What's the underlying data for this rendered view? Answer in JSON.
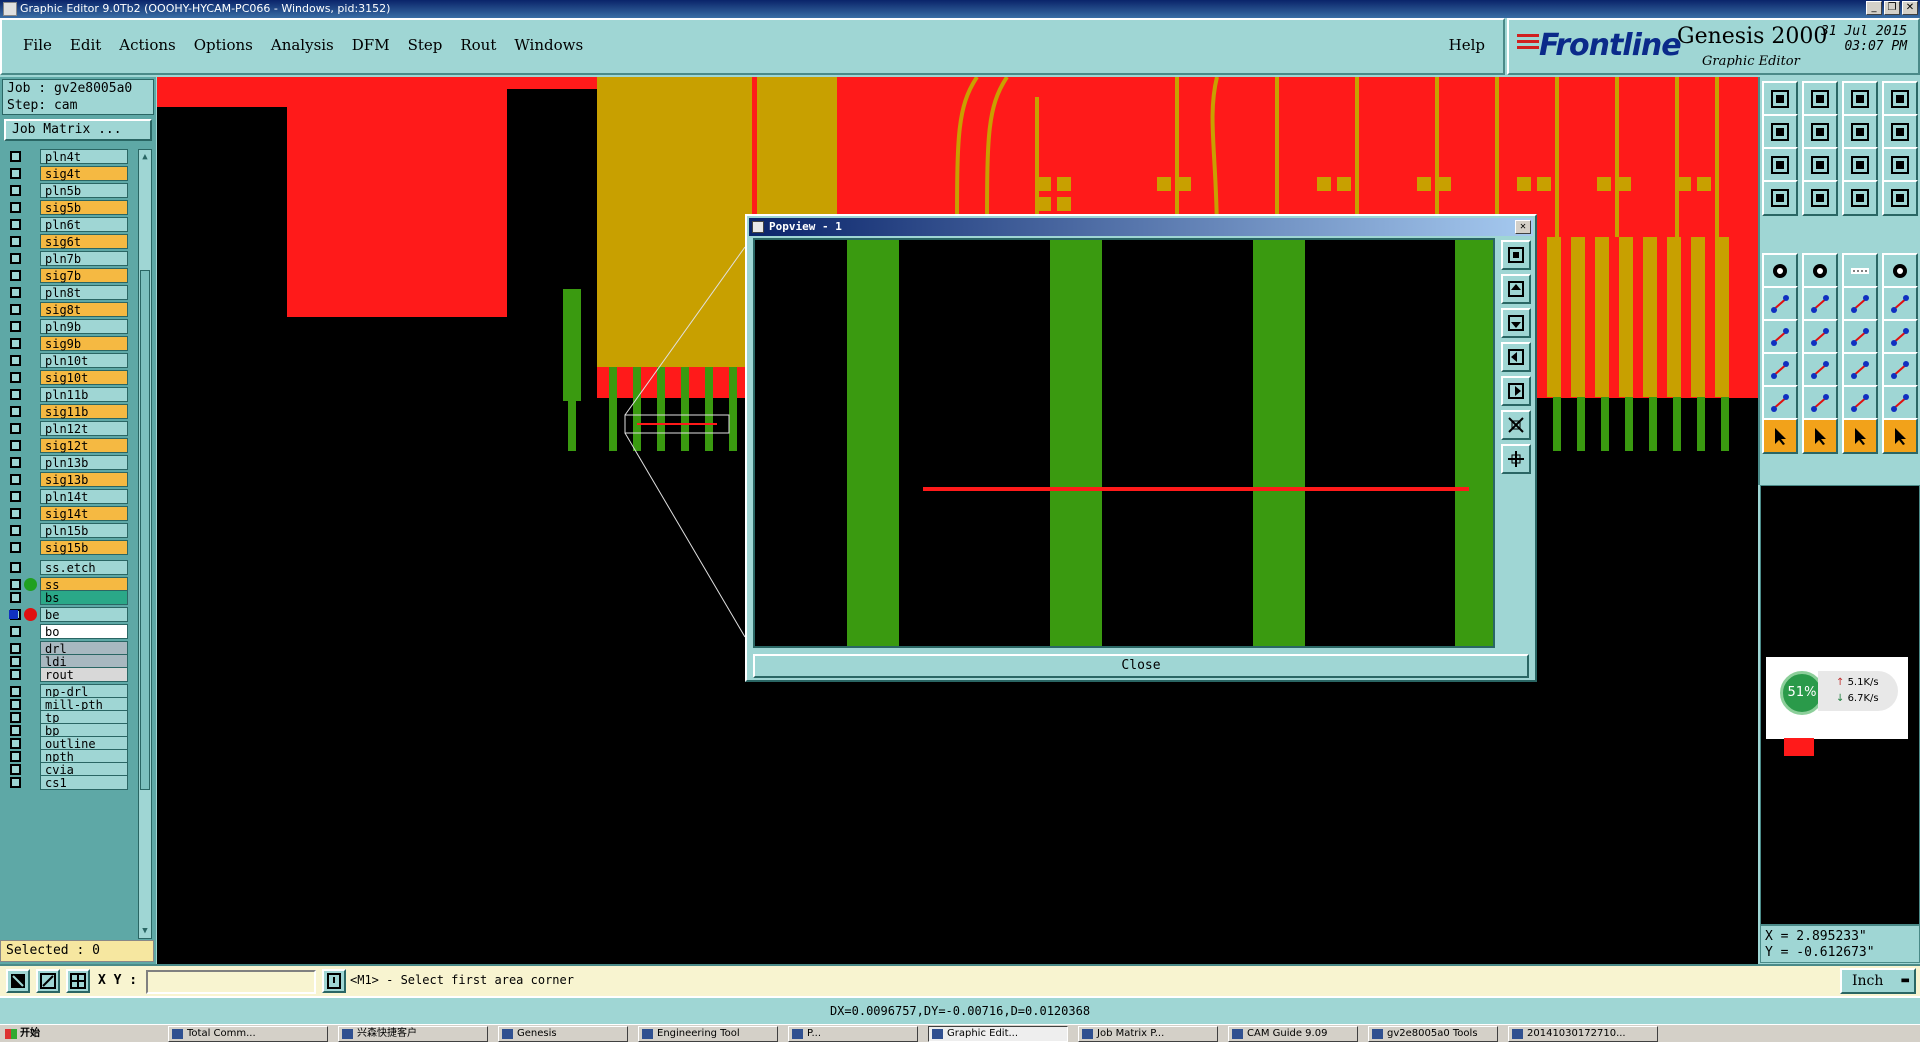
{
  "window": {
    "title": "Graphic Editor 9.0Tb2 (OOOHY-HYCAM-PC066 - Windows, pid:3152)",
    "controls": [
      "_",
      "❐",
      "✕"
    ]
  },
  "menu": {
    "items": [
      "File",
      "Edit",
      "Actions",
      "Options",
      "Analysis",
      "DFM",
      "Step",
      "Rout",
      "Windows"
    ],
    "help": "Help"
  },
  "logo": {
    "brand": "Frontline",
    "product": "Genesis 2000",
    "subtitle": "Graphic Editor",
    "date": "31 Jul 2015",
    "time": "03:07 PM"
  },
  "job": {
    "job_line": "Job : gv2e8005a0",
    "step_line": "Step: cam",
    "matrix_button": "Job Matrix ..."
  },
  "layers": [
    {
      "name": "pln4t",
      "color": "#9fd6d4"
    },
    {
      "name": "sig4t",
      "color": "#f5b942"
    },
    {
      "name": "pln5b",
      "color": "#9fd6d4"
    },
    {
      "name": "sig5b",
      "color": "#f5b942"
    },
    {
      "name": "pln6t",
      "color": "#9fd6d4"
    },
    {
      "name": "sig6t",
      "color": "#f5b942"
    },
    {
      "name": "pln7b",
      "color": "#9fd6d4"
    },
    {
      "name": "sig7b",
      "color": "#f5b942"
    },
    {
      "name": "pln8t",
      "color": "#9fd6d4"
    },
    {
      "name": "sig8t",
      "color": "#f5b942"
    },
    {
      "name": "pln9b",
      "color": "#9fd6d4"
    },
    {
      "name": "sig9b",
      "color": "#f5b942"
    },
    {
      "name": "pln10t",
      "color": "#9fd6d4"
    },
    {
      "name": "sig10t",
      "color": "#f5b942"
    },
    {
      "name": "pln11b",
      "color": "#9fd6d4"
    },
    {
      "name": "sig11b",
      "color": "#f5b942"
    },
    {
      "name": "pln12t",
      "color": "#9fd6d4"
    },
    {
      "name": "sig12t",
      "color": "#f5b942"
    },
    {
      "name": "pln13b",
      "color": "#9fd6d4"
    },
    {
      "name": "sig13b",
      "color": "#f5b942"
    },
    {
      "name": "pln14t",
      "color": "#9fd6d4"
    },
    {
      "name": "sig14t",
      "color": "#f5b942"
    },
    {
      "name": "pln15b",
      "color": "#9fd6d4"
    },
    {
      "name": "sig15b",
      "color": "#f5b942"
    },
    {
      "name": "ss.etch",
      "color": "#9fd6d4"
    },
    {
      "name": "ss",
      "color": "#f5b942",
      "marker": "green-dot"
    },
    {
      "name": "bs",
      "color": "#2aa888"
    },
    {
      "name": "be",
      "color": "#9fd6d4",
      "marker": "red-dot"
    },
    {
      "name": "bo",
      "color": "#ffffff"
    },
    {
      "name": "drl",
      "color": "#a8b8c0"
    },
    {
      "name": "ldi",
      "color": "#a8b8c0"
    },
    {
      "name": "rout",
      "color": "#d8d8d8"
    },
    {
      "name": "np-drl",
      "color": "#9fd6d4"
    },
    {
      "name": "mill-pth",
      "color": "#9fd6d4"
    },
    {
      "name": "tp",
      "color": "#9fd6d4"
    },
    {
      "name": "bp",
      "color": "#9fd6d4"
    },
    {
      "name": "outline",
      "color": "#9fd6d4"
    },
    {
      "name": "npth",
      "color": "#9fd6d4"
    },
    {
      "name": "cvia",
      "color": "#9fd6d4"
    },
    {
      "name": "cs1",
      "color": "#9fd6d4"
    }
  ],
  "selected": "Selected : 0",
  "popview": {
    "title": "Popview - 1",
    "close_label": "Close"
  },
  "netmon": {
    "percent": "51%",
    "upload": "5.1K/s",
    "download": "6.7K/s"
  },
  "coords": {
    "x": "X = 2.895233\"",
    "y": "Y = -0.612673\""
  },
  "command": {
    "xy_label": "X Y :",
    "xy_value": "",
    "prompt": "<M1> - Select first area corner",
    "units": "Inch"
  },
  "status": "DX=0.0096757,DY=-0.00716,D=0.0120368",
  "taskbar": {
    "start": "开始",
    "tasks": [
      "Total Comm...",
      "兴森快捷客户",
      "Genesis",
      "Engineering Tool",
      "P...",
      "Graphic Edit...",
      "Job Matrix P...",
      "CAM Guide 9.09",
      "gv2e8005a0 Tools",
      "20141030172710..."
    ]
  },
  "colors": {
    "copper": "#ff1a1a",
    "gold": "#c8a000",
    "green": "#3a9a10",
    "panel": "#9fd6d4"
  }
}
